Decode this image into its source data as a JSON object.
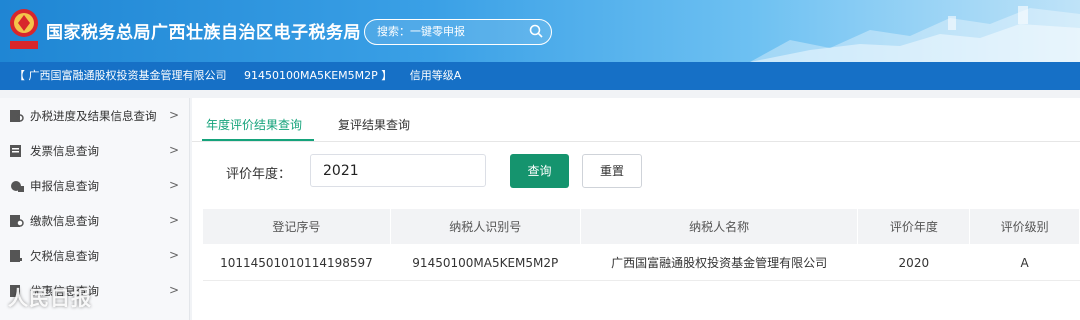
{
  "header": {
    "title": "国家税务总局广西壮族自治区电子税务局",
    "search_placeholder": "搜索：一键零申报"
  },
  "subbar": {
    "company": "【 广西国富融通股权投资基金管理有限公司",
    "tax_id": "91450100MA5KEM5M2P 】",
    "credit_level": "信用等级A"
  },
  "sidebar": {
    "items": [
      {
        "label": "办税进度及结果信息查询"
      },
      {
        "label": "发票信息查询"
      },
      {
        "label": "申报信息查询"
      },
      {
        "label": "缴款信息查询"
      },
      {
        "label": "欠税信息查询"
      },
      {
        "label": "优惠信息查询"
      }
    ]
  },
  "tabs": [
    {
      "label": "年度评价结果查询"
    },
    {
      "label": "复评结果查询"
    }
  ],
  "form": {
    "year_label": "评价年度：",
    "year_value": "2021",
    "query_button": "查询",
    "reset_button": "重置"
  },
  "table": {
    "headers": [
      "登记序号",
      "纳税人识别号",
      "纳税人名称",
      "评价年度",
      "评价级别"
    ],
    "rows": [
      [
        "10114501010114198597",
        "91450100MA5KEM5M2P",
        "广西国富融通股权投资基金管理有限公司",
        "2020",
        "A"
      ]
    ]
  },
  "watermark": "人民日报",
  "colors": {
    "accent_green": "#15946e",
    "header_blue": "#1f86d4",
    "subbar_blue": "#1670c6"
  }
}
